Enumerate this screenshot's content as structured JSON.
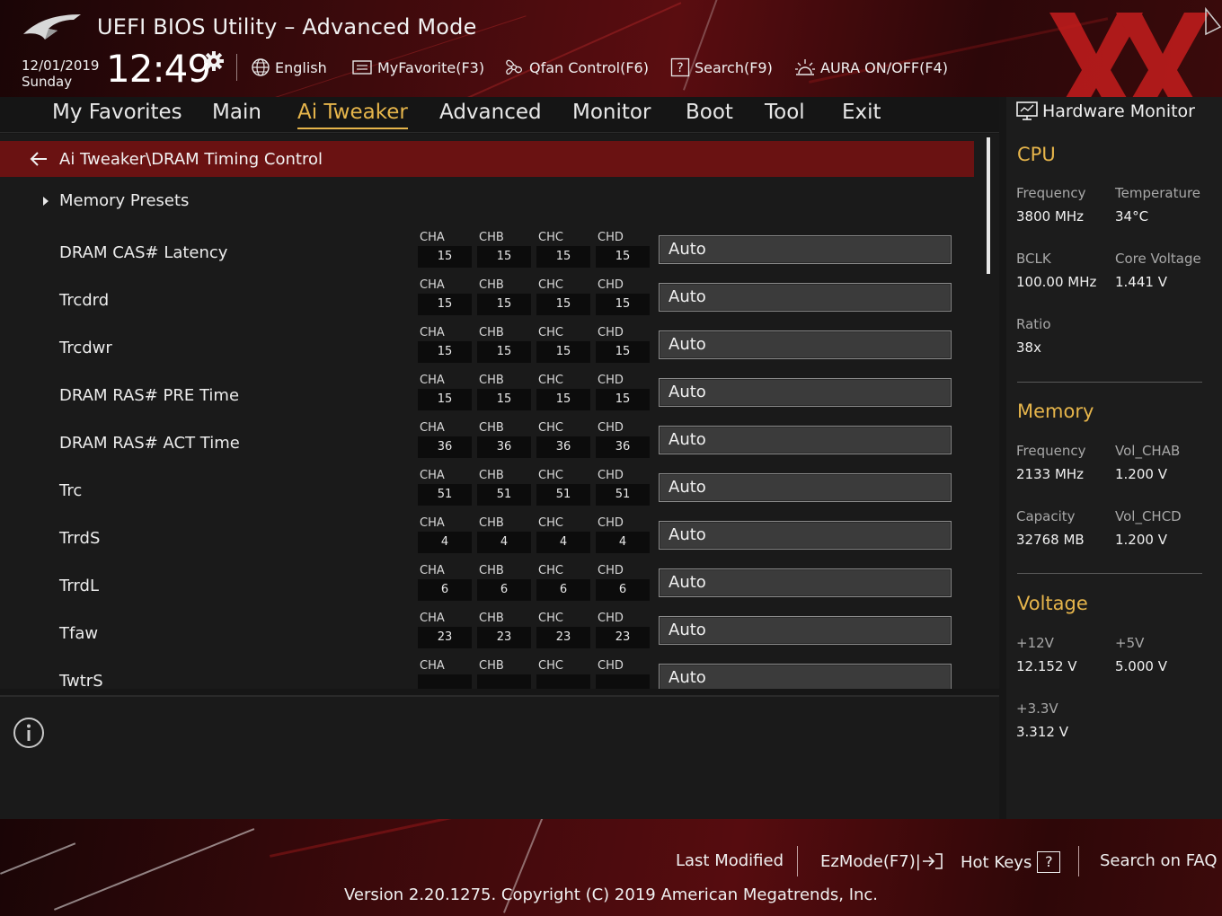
{
  "header": {
    "title": "UEFI BIOS Utility – Advanced Mode",
    "date": "12/01/2019",
    "weekday": "Sunday",
    "time": "12:49",
    "toolbar": [
      {
        "label": "English",
        "icon": "globe-icon"
      },
      {
        "label": "MyFavorite(F3)",
        "icon": "favorite-icon"
      },
      {
        "label": "Qfan Control(F6)",
        "icon": "fan-icon"
      },
      {
        "label": "Search(F9)",
        "icon": "search-help-icon"
      },
      {
        "label": "AURA ON/OFF(F4)",
        "icon": "aura-icon"
      }
    ]
  },
  "tabs": [
    {
      "label": "My Favorites"
    },
    {
      "label": "Main"
    },
    {
      "label": "Ai Tweaker",
      "active": true
    },
    {
      "label": "Advanced"
    },
    {
      "label": "Monitor"
    },
    {
      "label": "Boot"
    },
    {
      "label": "Tool"
    },
    {
      "label": "Exit"
    }
  ],
  "breadcrumb": "Ai Tweaker\\DRAM Timing Control",
  "presets_label": "Memory Presets",
  "channel_names": [
    "CHA",
    "CHB",
    "CHC",
    "CHD"
  ],
  "settings": [
    {
      "label": "DRAM CAS# Latency",
      "channels": [
        "15",
        "15",
        "15",
        "15"
      ],
      "value": "Auto"
    },
    {
      "label": "Trcdrd",
      "channels": [
        "15",
        "15",
        "15",
        "15"
      ],
      "value": "Auto"
    },
    {
      "label": "Trcdwr",
      "channels": [
        "15",
        "15",
        "15",
        "15"
      ],
      "value": "Auto"
    },
    {
      "label": "DRAM RAS# PRE Time",
      "channels": [
        "15",
        "15",
        "15",
        "15"
      ],
      "value": "Auto"
    },
    {
      "label": "DRAM RAS# ACT Time",
      "channels": [
        "36",
        "36",
        "36",
        "36"
      ],
      "value": "Auto"
    },
    {
      "label": "Trc",
      "channels": [
        "51",
        "51",
        "51",
        "51"
      ],
      "value": "Auto"
    },
    {
      "label": "TrrdS",
      "channels": [
        "4",
        "4",
        "4",
        "4"
      ],
      "value": "Auto"
    },
    {
      "label": "TrrdL",
      "channels": [
        "6",
        "6",
        "6",
        "6"
      ],
      "value": "Auto"
    },
    {
      "label": "Tfaw",
      "channels": [
        "23",
        "23",
        "23",
        "23"
      ],
      "value": "Auto"
    },
    {
      "label": "TwtrS",
      "channels": [
        "",
        "",
        "",
        ""
      ],
      "value": "Auto"
    }
  ],
  "hardware_monitor": {
    "title": "Hardware Monitor",
    "cpu": {
      "section": "CPU",
      "frequency_label": "Frequency",
      "frequency": "3800 MHz",
      "temperature_label": "Temperature",
      "temperature": "34°C",
      "bclk_label": "BCLK",
      "bclk": "100.00 MHz",
      "core_voltage_label": "Core Voltage",
      "core_voltage": "1.441 V",
      "ratio_label": "Ratio",
      "ratio": "38x"
    },
    "memory": {
      "section": "Memory",
      "frequency_label": "Frequency",
      "frequency": "2133 MHz",
      "vol_chab_label": "Vol_CHAB",
      "vol_chab": "1.200 V",
      "capacity_label": "Capacity",
      "capacity": "32768 MB",
      "vol_chcd_label": "Vol_CHCD",
      "vol_chcd": "1.200 V"
    },
    "voltage": {
      "section": "Voltage",
      "v12_label": "+12V",
      "v12": "12.152 V",
      "v5_label": "+5V",
      "v5": "5.000 V",
      "v33_label": "+3.3V",
      "v33": "3.312 V"
    }
  },
  "footer": {
    "last_modified": "Last Modified",
    "ezmode": "EzMode(F7)|",
    "hot_keys": "Hot Keys",
    "hot_keys_key": "?",
    "faq": "Search on FAQ",
    "version": "Version 2.20.1275. Copyright (C) 2019 American Megatrends, Inc."
  },
  "colors": {
    "accent": "#e6b54b",
    "breadcrumb_bg": "#6a1212",
    "header_red": "#5a0d10"
  }
}
